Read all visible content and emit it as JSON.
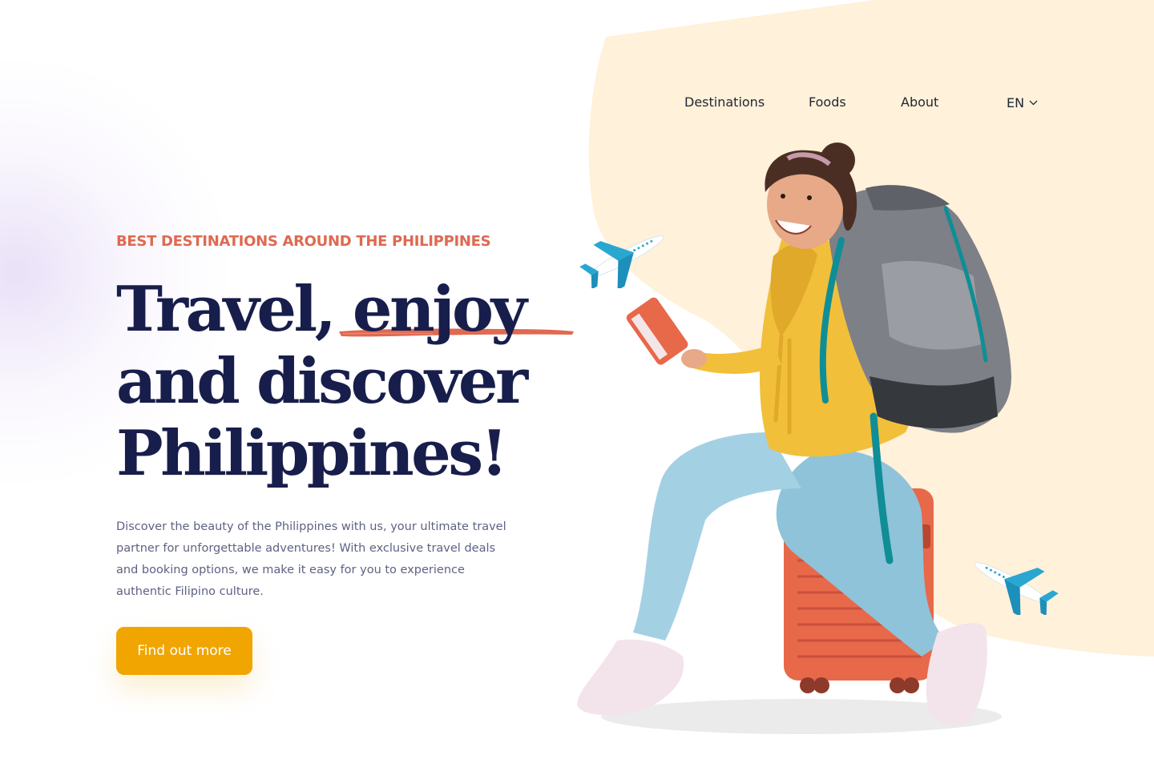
{
  "nav": {
    "links": [
      "Destinations",
      "Foods",
      "About"
    ],
    "language": "EN"
  },
  "hero": {
    "eyebrow": "BEST DESTINATIONS AROUND THE PHILIPPINES",
    "headline": {
      "part1": "Travel, ",
      "highlight": "enjoy",
      "line2": "and discover",
      "line3": "Philippines!"
    },
    "description": "Discover the beauty of the Philippines with us, your ultimate travel partner for unforgettable adventures! With exclusive travel deals and booking options, we make it easy for you to experience authentic Filipino culture.",
    "cta_label": "Find out more"
  },
  "colors": {
    "accent": "#DF6951",
    "heading": "#181E4B",
    "body_text": "#5E6282",
    "button": "#F1A501",
    "blob": "#FFF1DA",
    "plane": "#2AA7D1"
  },
  "icons": [
    "chevron-down-icon",
    "airplane-icon",
    "traveler-illustration"
  ]
}
